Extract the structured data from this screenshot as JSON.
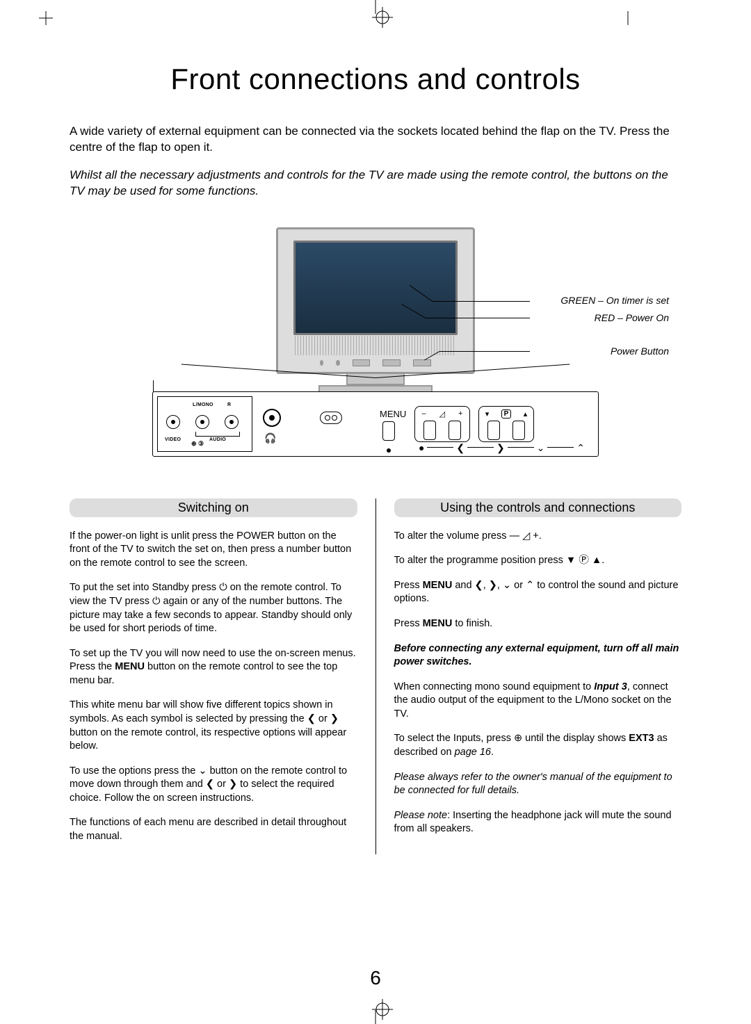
{
  "page": {
    "title": "Front connections and controls",
    "intro": "A wide variety of external equipment can be connected via the sockets located behind the flap on the TV. Press the centre of the flap to open it.",
    "intro_note": "Whilst all the necessary adjustments and controls for the TV are made using the remote control, the buttons on the TV may be used for some functions.",
    "page_number": "6"
  },
  "diagram": {
    "annot_green": "GREEN – On timer is set",
    "annot_red": "RED – Power On",
    "annot_power": "Power Button",
    "panel": {
      "lmono": "L/MONO",
      "r": "R",
      "video": "VIDEO",
      "audio": "AUDIO",
      "input_sym": "⊕ ③",
      "menu": "MENU",
      "vol_minus": "–",
      "vol_plus": "+",
      "prog_p": "P"
    },
    "symbol_row": [
      "●",
      "❮",
      "❯",
      "❯",
      "❮"
    ]
  },
  "left": {
    "heading": "Switching on",
    "p1": "If the power-on light is unlit press the POWER button on the front of the TV to switch the set on, then press a number button on the remote control to see the screen.",
    "p2a": "To put the set into Standby press ",
    "p2b": " on the remote control. To view the TV press ",
    "p2c": " again or any of the number buttons. The picture may take a few seconds to appear. Standby should only be used for short periods of time.",
    "p3a": "To set up the TV you will now need to use the on-screen menus. Press the ",
    "p3menu": "MENU",
    "p3b": " button on the remote control to see the top menu bar.",
    "p4a": "This white menu bar will show five different topics shown in symbols. As each symbol is selected by pressing the ",
    "p4b": " or ",
    "p4c": " button on the remote control, its respective options will appear below.",
    "p5a": "To use the options press the ",
    "p5b": " button on the remote control to move down through them and ",
    "p5c": " or ",
    "p5d": " to select the required choice. Follow the on screen instructions.",
    "p6": "The functions of each menu are described in detail throughout the manual."
  },
  "right": {
    "heading": "Using the controls and connections",
    "p1a": "To alter the volume press ",
    "p1b": ".",
    "p2a": "To alter the programme position press ",
    "p2b": ".",
    "p3a": "Press ",
    "p3menu": "MENU",
    "p3b": " and ",
    "p3c": ", ",
    "p3d": ", ",
    "p3e": " or ",
    "p3f": " to control the sound and picture options.",
    "p4a": "Press ",
    "p4menu": "MENU",
    "p4b": " to finish.",
    "warn": "Before connecting any external equipment, turn off all main power switches.",
    "p5a": "When connecting mono sound equipment to ",
    "p5input": "Input 3",
    "p5b": ", connect the audio output of the equipment to the L/Mono socket on the TV.",
    "p6a": "To select the Inputs, press ",
    "p6b": " until the display shows ",
    "p6ext": "EXT3",
    "p6c": " as described on ",
    "p6page": "page 16",
    "p6d": ".",
    "p7": "Please always refer to the owner's manual of the equipment to be connected for full details.",
    "p8a": "Please note",
    "p8b": ": Inserting the headphone jack will mute the sound from all speakers."
  },
  "glyph": {
    "standby": "⏻",
    "chev_l": "❮",
    "chev_r": "❯",
    "chev_d": "⌄",
    "chev_u": "⌃",
    "vol_minus": "—",
    "vol_tri": "◿",
    "vol_plus": "+",
    "tri_d": "▼",
    "tri_u": "▲",
    "p_boxed": "Ⓟ",
    "input": "⊕"
  }
}
